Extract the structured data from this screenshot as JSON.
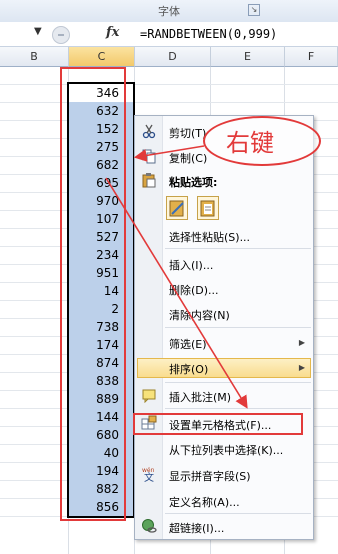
{
  "ribbon": {
    "group_label": "字体",
    "launcher_glyph": "↘"
  },
  "formula_bar": {
    "namebox_arrow": "▼",
    "fx_label": "fx",
    "formula": "=RANDBETWEEN(0,999)"
  },
  "columns": [
    "B",
    "C",
    "D",
    "E",
    "F"
  ],
  "selected_column": "C",
  "cells": [
    "346",
    "632",
    "152",
    "275",
    "682",
    "695",
    "970",
    "107",
    "527",
    "234",
    "951",
    "14",
    "2",
    "738",
    "174",
    "874",
    "838",
    "889",
    "144",
    "680",
    "40",
    "194",
    "882",
    "856"
  ],
  "context_menu": {
    "items": [
      {
        "label": "剪切(T)",
        "icon": "scissors-icon"
      },
      {
        "label": "复制(C)",
        "icon": "copy-icon"
      },
      {
        "label": "粘贴选项:",
        "icon": "paste-icon"
      },
      {
        "label": "选择性粘贴(S)...",
        "icon": ""
      },
      {
        "label": "插入(I)...",
        "icon": ""
      },
      {
        "label": "删除(D)...",
        "icon": ""
      },
      {
        "label": "清除内容(N)",
        "icon": ""
      },
      {
        "label": "筛选(E)",
        "icon": "",
        "submenu": true
      },
      {
        "label": "排序(O)",
        "icon": "",
        "submenu": true,
        "highlighted": true
      },
      {
        "label": "插入批注(M)",
        "icon": "comment-icon"
      },
      {
        "label": "设置单元格格式(F)...",
        "icon": "format-cells-icon"
      },
      {
        "label": "从下拉列表中选择(K)...",
        "icon": ""
      },
      {
        "label": "显示拼音字段(S)",
        "icon": "phonetic-icon"
      },
      {
        "label": "定义名称(A)...",
        "icon": ""
      },
      {
        "label": "超链接(I)...",
        "icon": "hyperlink-icon"
      }
    ]
  },
  "annotation": {
    "callout_text": "右键",
    "color": "#e23a3a"
  },
  "colors": {
    "selection_fill": "#bcd0ea",
    "header_selected": "#f2c96b",
    "menu_hover": "#f9dc8e"
  }
}
